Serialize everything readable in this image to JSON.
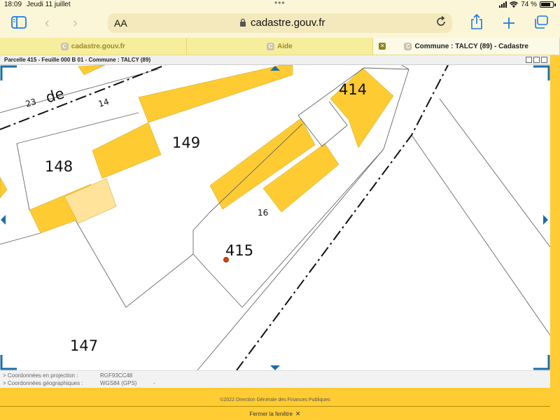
{
  "status_bar": {
    "time": "18:09",
    "date": "Jeudi 11 juillet",
    "battery": "74 %"
  },
  "browser": {
    "text_size_label": "AA",
    "url": "cadastre.gouv.fr",
    "accent_color": "#1e7be4"
  },
  "tabs": [
    {
      "label": "cadastre.gouv.fr",
      "favicon": "C",
      "active": false
    },
    {
      "label": "Aide",
      "favicon": "C",
      "active": false
    },
    {
      "label": "Commune : TALCY (89) - Cadastre",
      "favicon": "C",
      "active": true
    }
  ],
  "page_header": {
    "title": "Parcelle 415 - Feuille 000 B 01 - Commune : TALCY (89)"
  },
  "map": {
    "labels": {
      "street_number_23": "23",
      "street_word": "de",
      "street_number_14": "14",
      "parcel_149": "149",
      "parcel_148": "148",
      "parcel_414": "414",
      "street_number_16": "16",
      "parcel_415": "415",
      "parcel_147": "147"
    },
    "building_color": "#ffcb33",
    "selected_marker_color": "#d8400a",
    "frame_color": "#1b6ea8"
  },
  "coordinates": {
    "projection_label": "> Coordonnées en projection :",
    "projection_system": "RGF93CC48",
    "geographic_label": "> Coordonnées géographiques :",
    "geographic_system": "WGS84 (GPS)",
    "geographic_value": "-"
  },
  "footer": {
    "copyright": "©2022 Direction Générale des Finances Publiques",
    "close_window": "Fermer la fenêtre"
  }
}
